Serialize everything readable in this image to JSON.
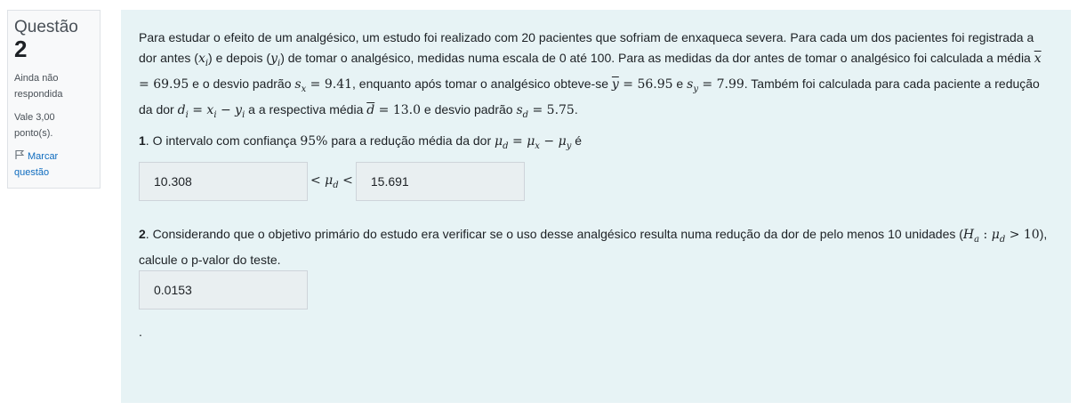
{
  "info": {
    "question_word": "Questão",
    "question_number": "2",
    "status": "Ainda não respondida",
    "grade": "Vale 3,00 ponto(s).",
    "flag_label": "Marcar questão"
  },
  "question": {
    "p1": "Para estudar o efeito de um analgésico, um estudo foi realizado com 20 pacientes que sofriam de enxaqueca severa. Para cada um dos pacientes foi registrada a dor antes (",
    "p2": ") e depois (",
    "p3": ") de tomar o analgésico, medidas numa escala de 0 até 100. Para as medidas da dor antes de tomar o analgésico foi calculada a média ",
    "mean_x": "69.95",
    "p4": " e o desvio padrão ",
    "sd_x": "9.41",
    "p5": ", enquanto após tomar o analgésico obteve-se ",
    "mean_y": "56.95",
    "p6": " e ",
    "sd_y": "7.99",
    "p7": ". Também foi calculada para cada paciente a redução da dor ",
    "p8": " a a respectiva média ",
    "mean_d": "13.0",
    "p9": " e desvio padrão ",
    "sd_d": "5.75",
    "p10": "."
  },
  "part1": {
    "number": "1",
    "text": ". O intervalo com confiança ",
    "confidence": "95%",
    "text2": " para a redução média da dor ",
    "text3": " é",
    "lower": "10.308",
    "upper": "15.691"
  },
  "part2": {
    "number": "2",
    "text": ". Considerando que o objetivo primário do estudo era verificar se o uso desse analgésico resulta numa redução da dor de pelo menos 10 unidades (",
    "hyp_value": "10",
    "text2": "), calcule o p-valor do teste.",
    "answer": "0.0153"
  },
  "trailing": "."
}
